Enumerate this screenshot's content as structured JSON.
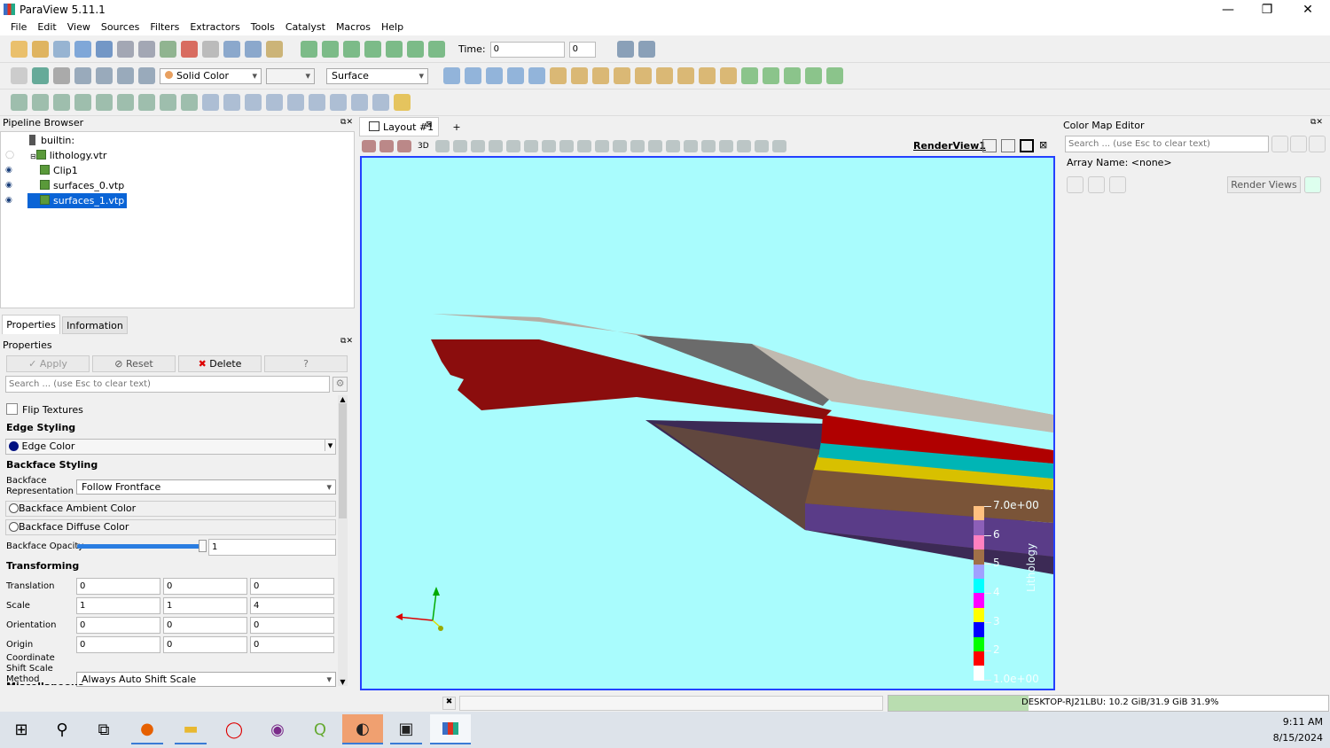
{
  "window": {
    "title": "ParaView 5.11.1"
  },
  "menu": [
    "File",
    "Edit",
    "View",
    "Sources",
    "Filters",
    "Extractors",
    "Tools",
    "Catalyst",
    "Macros",
    "Help"
  ],
  "toolbar1": {
    "icons": [
      "open-icon",
      "open-folder-icon",
      "save-data-icon",
      "save-state-icon",
      "load-state-icon",
      "connect-icon",
      "disconnect-icon",
      "reset-session-icon",
      "undo-icon",
      "redo-icon",
      "camera-undo-icon",
      "camera-redo-icon",
      "palette-icon"
    ],
    "anim_icons": [
      "first-frame-icon",
      "previous-frame-icon",
      "reverse-play-icon",
      "play-icon",
      "next-frame-icon",
      "last-frame-icon",
      "loop-icon"
    ],
    "time_label": "Time:",
    "time_value": "0",
    "time_index": "0",
    "tail_icons": [
      "find-data-icon",
      "zoom-to-data-icon"
    ]
  },
  "toolbar2": {
    "color_by": "Solid Color",
    "component": "",
    "representation": "Surface"
  },
  "pipeline": {
    "title": "Pipeline Browser",
    "items": [
      {
        "label": "builtin:"
      },
      {
        "label": "lithology.vtr"
      },
      {
        "label": "Clip1"
      },
      {
        "label": "surfaces_0.vtp"
      },
      {
        "label": "surfaces_1.vtp"
      }
    ]
  },
  "tabs": {
    "properties": "Properties",
    "information": "Information"
  },
  "properties": {
    "title": "Properties",
    "apply": "Apply",
    "reset": "Reset",
    "delete": "Delete",
    "help": "?",
    "search_placeholder": "Search ... (use Esc to clear text)",
    "flip_textures": "Flip Textures",
    "edge_styling": "Edge Styling",
    "edge_color": "Edge Color",
    "backface_styling": "Backface Styling",
    "backface_rep_label": "Backface Representation",
    "backface_rep_value": "Follow Frontface",
    "backface_ambient": "Backface Ambient Color",
    "backface_diffuse": "Backface Diffuse Color",
    "backface_opacity_label": "Backface Opacity",
    "backface_opacity_value": "1",
    "transforming": "Transforming",
    "translation_label": "Translation",
    "translation": [
      "0",
      "0",
      "0"
    ],
    "scale_label": "Scale",
    "scale": [
      "1",
      "1",
      "4"
    ],
    "orientation_label": "Orientation",
    "orientation": [
      "0",
      "0",
      "0"
    ],
    "origin_label": "Origin",
    "origin": [
      "0",
      "0",
      "0"
    ],
    "coord_shift_label": "Coordinate Shift Scale Method",
    "coord_shift_value": "Always Auto Shift Scale",
    "misc": "Miscellaneous"
  },
  "layout": {
    "tab": "Layout #1",
    "add": "+",
    "view_name": "RenderView1",
    "view_3d": "3D"
  },
  "legend": {
    "title": "Lithology",
    "max": "7.0e+00",
    "min": "1.0e+00",
    "ticks": [
      "6",
      "5",
      "4",
      "3",
      "2"
    ],
    "colors": [
      "#ffc080",
      "#8c5fb8",
      "#ff80c0",
      "#a07048",
      "#a0a0ff",
      "#00ffff",
      "#ff00ff",
      "#ffff00",
      "#0000ff",
      "#00ff00",
      "#ff0000",
      "#ffffff"
    ]
  },
  "colormap": {
    "title": "Color Map Editor",
    "search_placeholder": "Search ... (use Esc to clear text)",
    "array_name": "Array Name: <none>",
    "render_views": "Render Views"
  },
  "status": {
    "memory": "DESKTOP-RJ21LBU: 10.2 GiB/31.9 GiB 31.9%",
    "memory_fraction": 0.319
  },
  "taskbar": {
    "time": "9:11 AM",
    "date": "8/15/2024"
  }
}
